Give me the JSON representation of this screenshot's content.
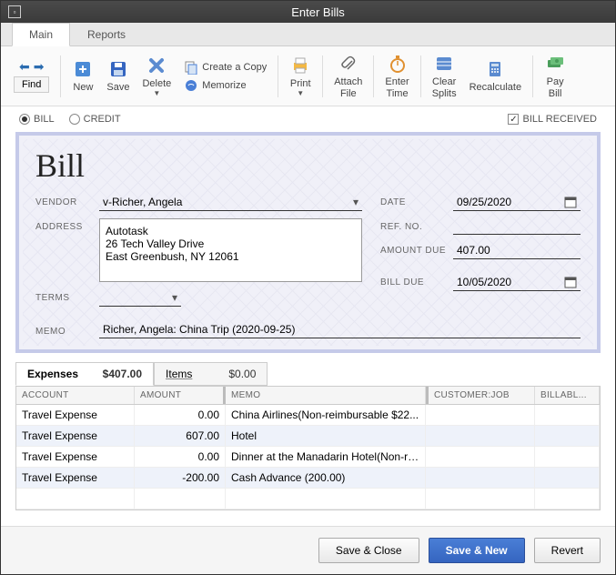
{
  "window": {
    "title": "Enter Bills"
  },
  "tabs": {
    "main": "Main",
    "reports": "Reports"
  },
  "toolbar": {
    "find": "Find",
    "new": "New",
    "save": "Save",
    "delete": "Delete",
    "create_copy": "Create a Copy",
    "memorize": "Memorize",
    "print": "Print",
    "attach_file": "Attach\nFile",
    "enter_time": "Enter\nTime",
    "clear_splits": "Clear\nSplits",
    "recalculate": "Recalculate",
    "pay_bill": "Pay\nBill"
  },
  "options": {
    "bill": "BILL",
    "credit": "CREDIT",
    "bill_received": "BILL RECEIVED"
  },
  "bill": {
    "title": "Bill",
    "labels": {
      "vendor": "VENDOR",
      "address": "ADDRESS",
      "terms": "TERMS",
      "memo": "MEMO",
      "date": "DATE",
      "ref_no": "REF. NO.",
      "amount_due": "AMOUNT DUE",
      "bill_due": "BILL DUE"
    },
    "vendor": "v-Richer, Angela",
    "address": "Autotask\n26 Tech Valley Drive\nEast Greenbush, NY 12061",
    "terms": "",
    "memo": "Richer, Angela: China Trip (2020-09-25)",
    "date": "09/25/2020",
    "ref_no": "",
    "amount_due": "407.00",
    "bill_due": "10/05/2020"
  },
  "subtabs": {
    "expenses_label": "Expenses",
    "expenses_amount": "$407.00",
    "items_label": "Items",
    "items_amount": "$0.00"
  },
  "grid": {
    "headers": {
      "account": "ACCOUNT",
      "amount": "AMOUNT",
      "memo": "MEMO",
      "customer": "CUSTOMER:JOB",
      "billable": "BILLABL..."
    },
    "rows": [
      {
        "account": "Travel Expense",
        "amount": "0.00",
        "memo": "China Airlines(Non-reimbursable $22..."
      },
      {
        "account": "Travel Expense",
        "amount": "607.00",
        "memo": "Hotel"
      },
      {
        "account": "Travel Expense",
        "amount": "0.00",
        "memo": "Dinner at the Manadarin Hotel(Non-rei..."
      },
      {
        "account": "Travel Expense",
        "amount": "-200.00",
        "memo": "Cash Advance (200.00)"
      }
    ]
  },
  "footer": {
    "save_close": "Save & Close",
    "save_new": "Save & New",
    "revert": "Revert"
  }
}
